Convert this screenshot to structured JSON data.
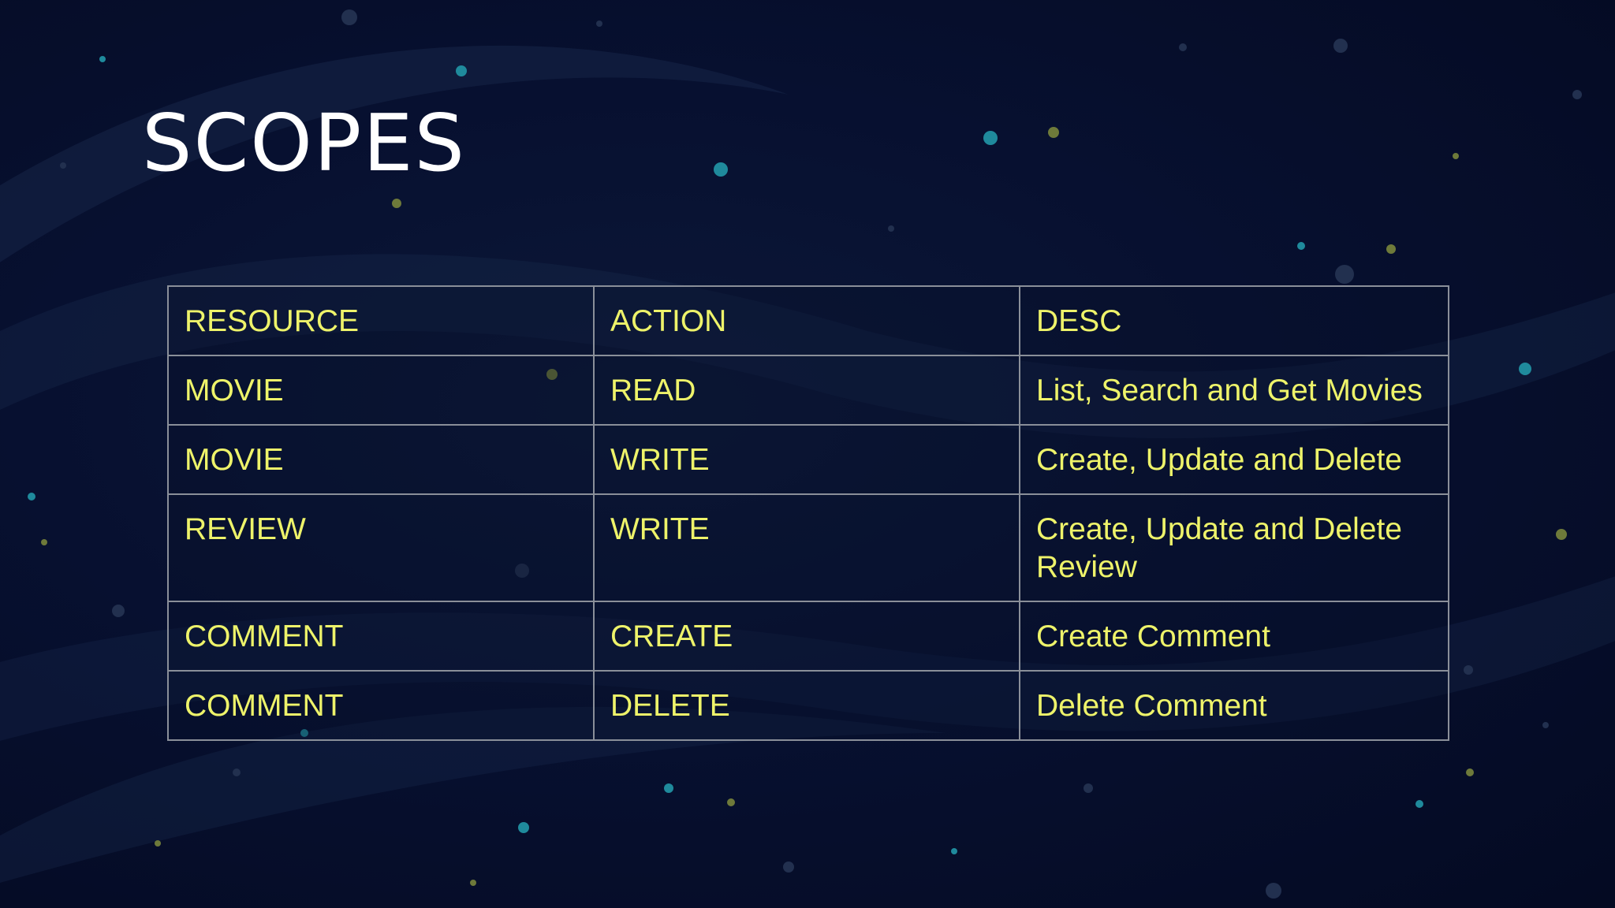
{
  "slide": {
    "title": "SCOPES",
    "accent_text_color": "#eef36a",
    "title_color": "#ffffff",
    "background_color": "#071030",
    "table": {
      "headers": [
        "RESOURCE",
        "ACTION",
        "DESC"
      ],
      "rows": [
        [
          "MOVIE",
          "READ",
          "List, Search and Get Movies"
        ],
        [
          "MOVIE",
          "WRITE",
          "Create, Update and Delete"
        ],
        [
          "REVIEW",
          "WRITE",
          "Create, Update and Delete Review"
        ],
        [
          "COMMENT",
          "CREATE",
          "Create Comment"
        ],
        [
          "COMMENT",
          "DELETE",
          "Delete Comment"
        ]
      ]
    }
  }
}
